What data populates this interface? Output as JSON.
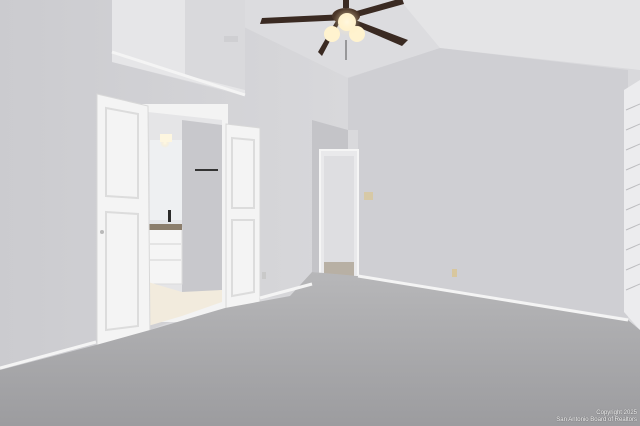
{
  "photo": {
    "watermark_line1": "Copyright 2025",
    "watermark_line2": "San Antonio Board of Realtors",
    "colors": {
      "wall": "#d4d4d8",
      "wall_right": "#cfcfd3",
      "ceiling": "#e4e4e6",
      "carpet": "#a9a9ab",
      "door": "#f4f4f4",
      "trim": "#f2f2f2",
      "fan_blade": "#3a2a22",
      "light": "#fff3cf"
    }
  }
}
